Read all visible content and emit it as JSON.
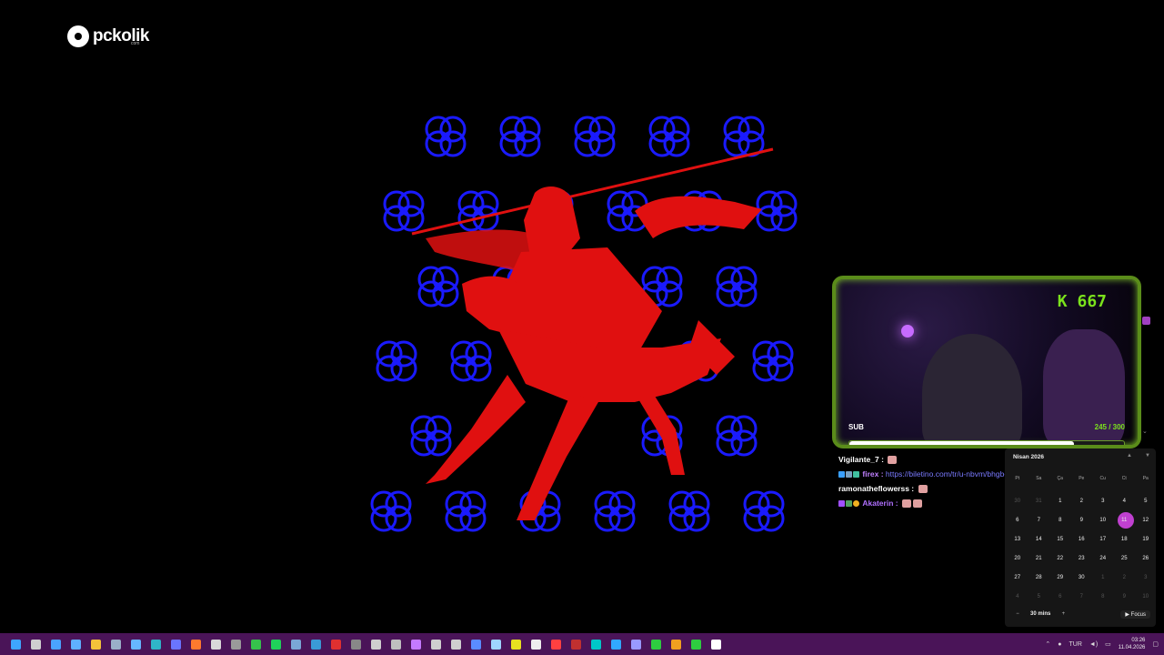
{
  "logo": {
    "brand": "pckolik",
    "sub": "com"
  },
  "stream": {
    "k_count": "667",
    "sub_label": "SUB",
    "sub_count": "245 / 300",
    "sub_progress": 0.8167
  },
  "chat": [
    {
      "user": "Vigilante_7 :",
      "text": ""
    },
    {
      "user": "firex :",
      "text": "https://biletino.com/tr/u-nbvm/bhgb-plakcilik/"
    },
    {
      "user": "ramonatheflowerss :",
      "text": ""
    },
    {
      "user": "Akaterin :",
      "text": ""
    }
  ],
  "calendar": {
    "month_label": "Nisan 2026",
    "weekdays": [
      "Pt",
      "Sa",
      "Ça",
      "Pe",
      "Cu",
      "Ct",
      "Pa"
    ],
    "days": [
      {
        "d": "30",
        "m": true
      },
      {
        "d": "31",
        "m": true
      },
      {
        "d": "1"
      },
      {
        "d": "2"
      },
      {
        "d": "3"
      },
      {
        "d": "4"
      },
      {
        "d": "5"
      },
      {
        "d": "6"
      },
      {
        "d": "7"
      },
      {
        "d": "8"
      },
      {
        "d": "9"
      },
      {
        "d": "10"
      },
      {
        "d": "11",
        "t": true
      },
      {
        "d": "12"
      },
      {
        "d": "13"
      },
      {
        "d": "14"
      },
      {
        "d": "15"
      },
      {
        "d": "16"
      },
      {
        "d": "17"
      },
      {
        "d": "18"
      },
      {
        "d": "19"
      },
      {
        "d": "20"
      },
      {
        "d": "21"
      },
      {
        "d": "22"
      },
      {
        "d": "23"
      },
      {
        "d": "24"
      },
      {
        "d": "25"
      },
      {
        "d": "26"
      },
      {
        "d": "27"
      },
      {
        "d": "28"
      },
      {
        "d": "29"
      },
      {
        "d": "30"
      },
      {
        "d": "1",
        "m": true
      },
      {
        "d": "2",
        "m": true
      },
      {
        "d": "3",
        "m": true
      },
      {
        "d": "4",
        "m": true
      },
      {
        "d": "5",
        "m": true
      },
      {
        "d": "6",
        "m": true
      },
      {
        "d": "7",
        "m": true
      },
      {
        "d": "8",
        "m": true
      },
      {
        "d": "9",
        "m": true
      },
      {
        "d": "10",
        "m": true
      }
    ],
    "minus": "−",
    "mins": "30 mins",
    "plus": "+",
    "focus": "▶ Focus"
  },
  "taskbar": {
    "icons": [
      {
        "name": "windows-start-icon",
        "color": "#3ea6ff"
      },
      {
        "name": "search-icon",
        "color": "#cfcfcf"
      },
      {
        "name": "widgets-icon",
        "color": "#4aa3ff"
      },
      {
        "name": "app-icon-1",
        "color": "#5fb0ff"
      },
      {
        "name": "file-explorer-icon",
        "color": "#f3c23a"
      },
      {
        "name": "app-icon-2",
        "color": "#9ab0c8"
      },
      {
        "name": "notepad-icon",
        "color": "#66b7ff"
      },
      {
        "name": "edge-icon",
        "color": "#2fb5c8"
      },
      {
        "name": "discord-icon",
        "color": "#6a75ff"
      },
      {
        "name": "app-icon-3",
        "color": "#ff7a2e"
      },
      {
        "name": "app-icon-4",
        "color": "#d9d9d9"
      },
      {
        "name": "app-icon-5",
        "color": "#9a9a9a"
      },
      {
        "name": "xbox-icon",
        "color": "#36c24c"
      },
      {
        "name": "spotify-icon",
        "color": "#1fd15a"
      },
      {
        "name": "steam-icon",
        "color": "#7aa7d6"
      },
      {
        "name": "app-icon-6",
        "color": "#3a9ad6"
      },
      {
        "name": "app-icon-7",
        "color": "#e03030"
      },
      {
        "name": "app-icon-8",
        "color": "#888"
      },
      {
        "name": "obs-icon",
        "color": "#cfcfcf"
      },
      {
        "name": "app-icon-9",
        "color": "#bfbfbf"
      },
      {
        "name": "app-icon-10",
        "color": "#c47aff"
      },
      {
        "name": "app-icon-11",
        "color": "#cfcfcf"
      },
      {
        "name": "app-icon-12",
        "color": "#cfcfcf"
      },
      {
        "name": "app-icon-13",
        "color": "#5a8cff"
      },
      {
        "name": "app-icon-14",
        "color": "#9fd6ff"
      },
      {
        "name": "app-icon-15",
        "color": "#e8e020"
      },
      {
        "name": "app-icon-16",
        "color": "#eeeeee"
      },
      {
        "name": "app-icon-17",
        "color": "#ff4040"
      },
      {
        "name": "app-icon-18",
        "color": "#c03030"
      },
      {
        "name": "audition-icon",
        "color": "#00c8c8"
      },
      {
        "name": "photoshop-icon",
        "color": "#31a8ff"
      },
      {
        "name": "premiere-icon",
        "color": "#9999ff"
      },
      {
        "name": "play-icon",
        "color": "#2ecc40"
      },
      {
        "name": "app-icon-19",
        "color": "#f0a020"
      },
      {
        "name": "app-icon-20",
        "color": "#2ecc40"
      },
      {
        "name": "app-icon-21",
        "color": "#ffffff"
      }
    ],
    "lang": "TUR",
    "time": "03:26",
    "date": "11.04.2026"
  }
}
